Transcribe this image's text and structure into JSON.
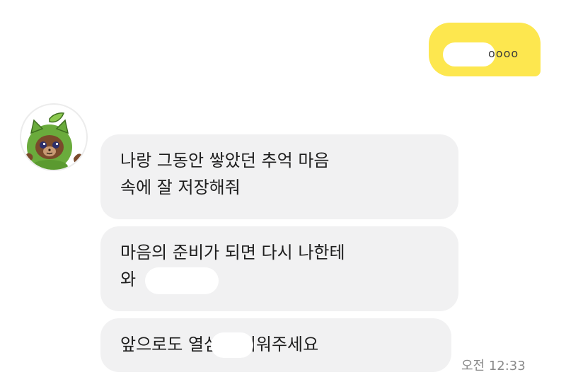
{
  "sent": {
    "text": "oooo"
  },
  "received": {
    "avatar_icon": "cat-in-leaf-hood-avatar",
    "messages": [
      "나랑 그동안 쌓았던 추억 마음\n속에 잘 저장해줘",
      "마음의 준비가 되면 다시 나한테\n와",
      "앞으로도          열심히 키워주세요"
    ],
    "time": "오전 12:33"
  },
  "colors": {
    "sent_bubble": "#fde74f",
    "received_bubble": "#f1f1f2",
    "time_text": "#8a8a8a"
  }
}
